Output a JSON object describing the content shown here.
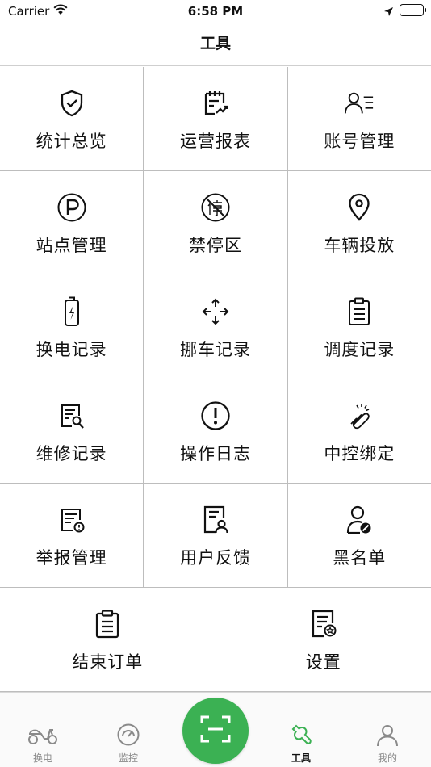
{
  "status_bar": {
    "carrier": "Carrier",
    "time": "6:58 PM"
  },
  "page_title": "工具",
  "tools": [
    {
      "label": "统计总览",
      "icon": "shield-check-icon"
    },
    {
      "label": "运营报表",
      "icon": "report-chart-icon"
    },
    {
      "label": "账号管理",
      "icon": "account-list-icon"
    },
    {
      "label": "站点管理",
      "icon": "parking-icon"
    },
    {
      "label": "禁停区",
      "icon": "no-parking-icon"
    },
    {
      "label": "车辆投放",
      "icon": "location-pin-icon"
    },
    {
      "label": "换电记录",
      "icon": "battery-charge-icon"
    },
    {
      "label": "挪车记录",
      "icon": "move-arrows-icon"
    },
    {
      "label": "调度记录",
      "icon": "clipboard-icon"
    },
    {
      "label": "维修记录",
      "icon": "repair-document-icon"
    },
    {
      "label": "操作日志",
      "icon": "exclamation-circle-icon"
    },
    {
      "label": "中控绑定",
      "icon": "link-bind-icon"
    },
    {
      "label": "举报管理",
      "icon": "report-warning-icon"
    },
    {
      "label": "用户反馈",
      "icon": "feedback-user-icon"
    },
    {
      "label": "黑名单",
      "icon": "blocked-user-icon"
    },
    {
      "label": "结束订单",
      "icon": "end-order-clipboard-icon"
    },
    {
      "label": "设置",
      "icon": "settings-document-icon"
    }
  ],
  "tabbar": {
    "items": [
      {
        "label": "换电",
        "icon": "scooter-icon",
        "active": false
      },
      {
        "label": "监控",
        "icon": "gauge-icon",
        "active": false
      },
      {
        "label": "工具",
        "icon": "wrench-icon",
        "active": true
      },
      {
        "label": "我的",
        "icon": "person-icon",
        "active": false
      }
    ],
    "scan_icon": "scan-icon"
  },
  "colors": {
    "accent": "#3bb153",
    "tab_inactive": "#8a8a8a",
    "grid_line": "#bdbdbd"
  }
}
